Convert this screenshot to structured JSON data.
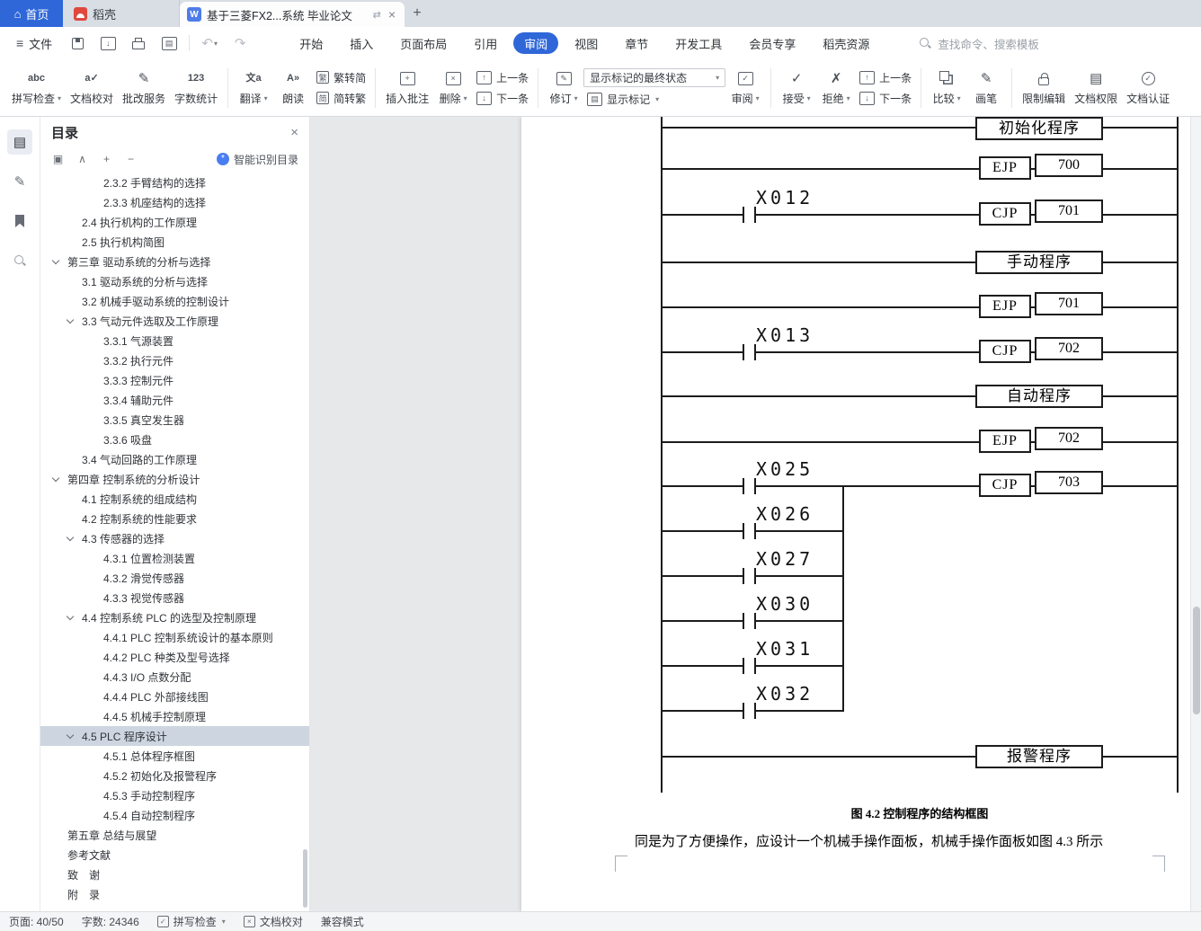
{
  "colors": {
    "accent_blue": "#2f67d9",
    "docer_red": "#e0483e",
    "selected_row": "#cdd5e0"
  },
  "tabbar": {
    "home": "首页",
    "docer": "稻壳",
    "document_title": "基于三菱FX2...系统 毕业论文",
    "new_tab": "+"
  },
  "menubar": {
    "file": "文件",
    "items": [
      {
        "label": "开始"
      },
      {
        "label": "插入"
      },
      {
        "label": "页面布局"
      },
      {
        "label": "引用"
      },
      {
        "label": "审阅",
        "cls": "active"
      },
      {
        "label": "视图"
      },
      {
        "label": "章节"
      },
      {
        "label": "开发工具"
      },
      {
        "label": "会员专享"
      },
      {
        "label": "稻壳资源"
      }
    ],
    "search_placeholder": "查找命令、搜索模板"
  },
  "ribbon": {
    "spell_check": "拼写检查",
    "doc_proofing": "文档校对",
    "correction_service": "批改服务",
    "word_count": "字数统计",
    "translate": "翻译",
    "read_aloud": "朗读",
    "trad_to_simp": "繁转简",
    "simp_to_trad": "简转繁",
    "insert_comment": "插入批注",
    "delete": "删除",
    "prev_comment": "上一条",
    "next_comment": "下一条",
    "track_changes": "修订",
    "markup_final_state": "显示标记的最终状态",
    "show_markup": "显示标记",
    "review": "审阅",
    "accept": "接受",
    "reject": "拒绝",
    "prev_change": "上一条",
    "next_change": "下一条",
    "compare": "比较",
    "pen": "画笔",
    "restrict_editing": "限制编辑",
    "doc_permission": "文档权限",
    "doc_auth": "文档认证"
  },
  "toc_panel": {
    "title": "目录",
    "smart_button": "智能识别目录",
    "items": [
      {
        "label": "2.3.2  手臂结构的选择",
        "cls": "l3"
      },
      {
        "label": "2.3.3  机座结构的选择",
        "cls": "l3"
      },
      {
        "label": "2.4  执行机构的工作原理",
        "cls": "l2"
      },
      {
        "label": "2.5  执行机构简图",
        "cls": "l2"
      },
      {
        "label": "第三章  驱动系统的分析与选择",
        "cls": "l1 chev"
      },
      {
        "label": "3.1  驱动系统的分析与选择",
        "cls": "l2"
      },
      {
        "label": "3.2  机械手驱动系统的控制设计",
        "cls": "l2"
      },
      {
        "label": "3.3  气动元件选取及工作原理",
        "cls": "l2 chev"
      },
      {
        "label": "3.3.1  气源装置",
        "cls": "l3"
      },
      {
        "label": "3.3.2  执行元件",
        "cls": "l3"
      },
      {
        "label": "3.3.3  控制元件",
        "cls": "l3"
      },
      {
        "label": "3.3.4  辅助元件",
        "cls": "l3"
      },
      {
        "label": "3.3.5  真空发生器",
        "cls": "l3"
      },
      {
        "label": "3.3.6  吸盘",
        "cls": "l3"
      },
      {
        "label": "3.4  气动回路的工作原理",
        "cls": "l2"
      },
      {
        "label": "第四章  控制系统的分析设计",
        "cls": "l1 chev"
      },
      {
        "label": "4.1  控制系统的组成结构",
        "cls": "l2"
      },
      {
        "label": "4.2  控制系统的性能要求",
        "cls": "l2"
      },
      {
        "label": "4.3  传感器的选择",
        "cls": "l2 chev"
      },
      {
        "label": "4.3.1  位置检测装置",
        "cls": "l3"
      },
      {
        "label": "4.3.2  滑觉传感器",
        "cls": "l3"
      },
      {
        "label": "4.3.3  视觉传感器",
        "cls": "l3"
      },
      {
        "label": "4.4  控制系统 PLC 的选型及控制原理",
        "cls": "l2 chev"
      },
      {
        "label": "4.4.1  PLC 控制系统设计的基本原则",
        "cls": "l3"
      },
      {
        "label": "4.4.2  PLC 种类及型号选择",
        "cls": "l3"
      },
      {
        "label": "4.4.3  I/O 点数分配",
        "cls": "l3"
      },
      {
        "label": "4.4.4  PLC 外部接线图",
        "cls": "l3"
      },
      {
        "label": "4.4.5  机械手控制原理",
        "cls": "l3"
      },
      {
        "label": "4.5  PLC 程序设计",
        "cls": "l2 chev sel"
      },
      {
        "label": "4.5.1  总体程序框图",
        "cls": "l3"
      },
      {
        "label": "4.5.2  初始化及报警程序",
        "cls": "l3"
      },
      {
        "label": "4.5.3  手动控制程序",
        "cls": "l3"
      },
      {
        "label": "4.5.4  自动控制程序",
        "cls": "l3"
      },
      {
        "label": "第五章  总结与展望",
        "cls": "l1"
      },
      {
        "label": "参考文献",
        "cls": "l1"
      },
      {
        "label": "致　谢",
        "cls": "l1"
      },
      {
        "label": "附　录",
        "cls": "l1"
      }
    ]
  },
  "document": {
    "diagram": {
      "program_boxes": [
        "初始化程序",
        "手动程序",
        "自动程序",
        "报警程序"
      ],
      "jumps": [
        {
          "op": "EJP",
          "addr": "700"
        },
        {
          "op": "CJP",
          "addr": "701"
        },
        {
          "op": "EJP",
          "addr": "701"
        },
        {
          "op": "CJP",
          "addr": "702"
        },
        {
          "op": "EJP",
          "addr": "702"
        },
        {
          "op": "CJP",
          "addr": "703"
        }
      ],
      "contacts": [
        "X012",
        "X013",
        "X025",
        "X026",
        "X027",
        "X030",
        "X031",
        "X032"
      ]
    },
    "figure_caption": "图 4.2   控制程序的结构框图",
    "paragraph": "同是为了方便操作，应设计一个机械手操作面板，机械手操作面板如图 4.3 所示"
  },
  "statusbar": {
    "page": "页面: 40/50",
    "words": "字数: 24346",
    "spellcheck": "拼写检查",
    "doc_proofing": "文档校对",
    "compat_mode": "兼容模式"
  }
}
